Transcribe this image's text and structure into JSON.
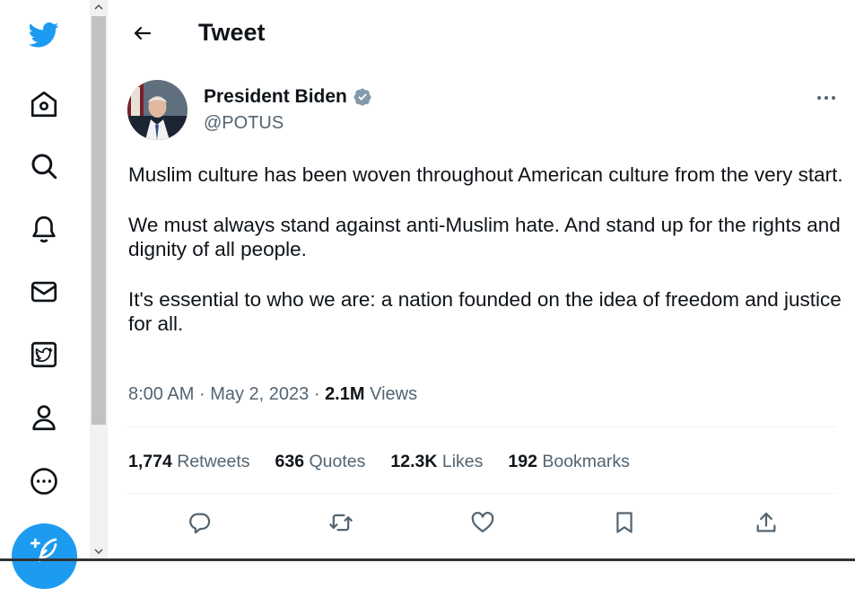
{
  "colors": {
    "brand": "#1d9bf0",
    "text": "#0f1419",
    "muted": "#536471",
    "divider": "#eff3f4"
  },
  "nav": {
    "items": [
      {
        "name": "twitter-logo-icon",
        "icon": "twitter-bird"
      },
      {
        "name": "home-icon",
        "icon": "home"
      },
      {
        "name": "explore-icon",
        "icon": "search"
      },
      {
        "name": "notifications-icon",
        "icon": "bell"
      },
      {
        "name": "messages-icon",
        "icon": "envelope"
      },
      {
        "name": "twitter-blue-icon",
        "icon": "twitter-blue"
      },
      {
        "name": "profile-icon",
        "icon": "person"
      },
      {
        "name": "more-icon",
        "icon": "ellipsis-circle"
      }
    ],
    "compose_icon": "feather-plus"
  },
  "header": {
    "title": "Tweet",
    "back_icon": "arrow-left"
  },
  "tweet": {
    "author": {
      "name": "President Biden",
      "handle": "@POTUS",
      "verified_icon": "verified-badge"
    },
    "more_icon": "ellipsis-horizontal",
    "paragraphs": [
      "Muslim culture has been woven throughout American culture from the very start.",
      "We must always stand against anti-Muslim hate. And stand up for the rights and dignity of all people.",
      "It's essential to who we are: a nation founded on the idea of freedom and justice for all."
    ],
    "time": "8:00 AM",
    "date": "May 2, 2023",
    "views_count": "2.1M",
    "views_label": "Views",
    "separator": "·"
  },
  "stats": {
    "retweets": {
      "count": "1,774",
      "label": "Retweets"
    },
    "quotes": {
      "count": "636",
      "label": "Quotes"
    },
    "likes": {
      "count": "12.3K",
      "label": "Likes"
    },
    "bookmarks": {
      "count": "192",
      "label": "Bookmarks"
    }
  },
  "actions": [
    {
      "name": "reply-icon",
      "icon": "comment"
    },
    {
      "name": "retweet-icon",
      "icon": "retweet"
    },
    {
      "name": "like-icon",
      "icon": "heart"
    },
    {
      "name": "bookmark-icon",
      "icon": "bookmark"
    },
    {
      "name": "share-icon",
      "icon": "share"
    }
  ]
}
